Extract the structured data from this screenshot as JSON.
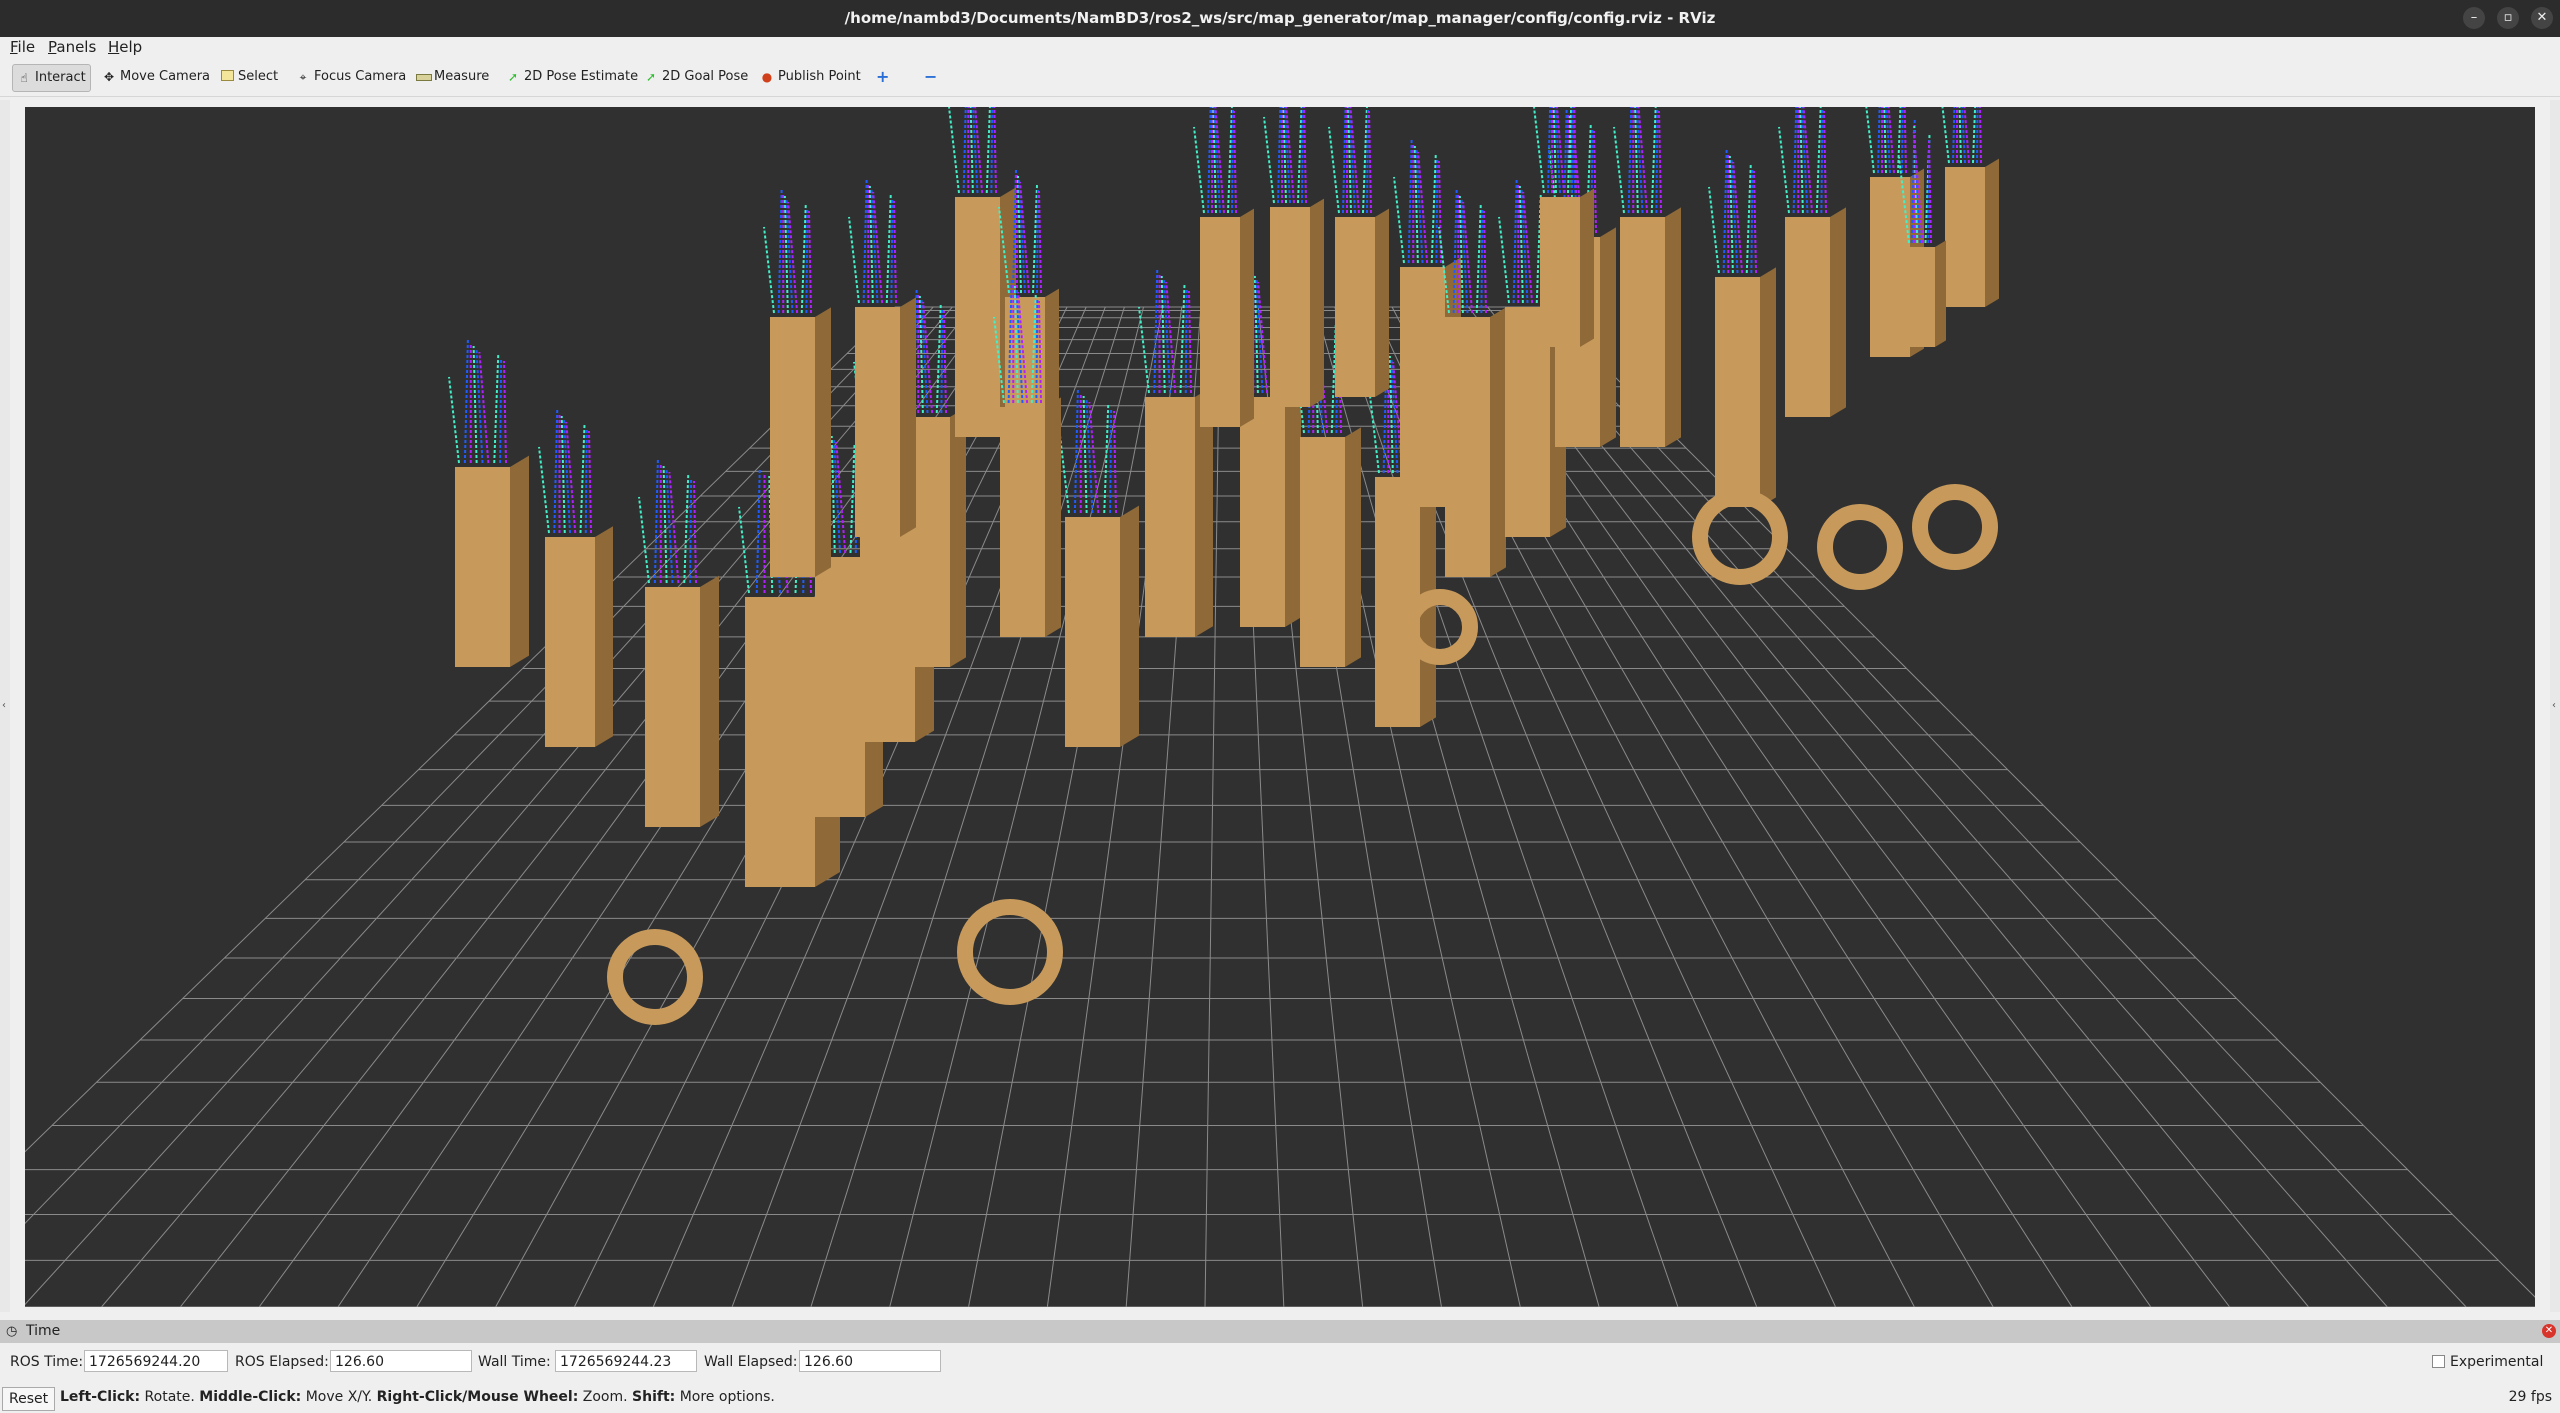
{
  "window": {
    "title": "/home/nambd3/Documents/NamBD3/ros2_ws/src/map_generator/map_manager/config/config.rviz - RViz",
    "minimize_glyph": "–",
    "maximize_glyph": "▫",
    "close_glyph": "✕"
  },
  "menu": {
    "file": {
      "accel": "F",
      "rest": "ile"
    },
    "panels": {
      "accel": "P",
      "rest": "anels"
    },
    "help": {
      "accel": "H",
      "rest": "elp"
    }
  },
  "toolbar": {
    "tools": [
      {
        "label": "Interact",
        "icon": "hand-cursor-icon"
      },
      {
        "label": "Move Camera",
        "icon": "move-camera-icon"
      },
      {
        "label": "Select",
        "icon": "select-box-icon"
      },
      {
        "label": "Focus Camera",
        "icon": "focus-target-icon"
      },
      {
        "label": "Measure",
        "icon": "ruler-icon"
      },
      {
        "label": "2D Pose Estimate",
        "icon": "green-arrow-icon"
      },
      {
        "label": "2D Goal Pose",
        "icon": "green-arrow-icon"
      },
      {
        "label": "Publish Point",
        "icon": "map-pin-icon"
      }
    ],
    "add_tool_glyph": "+",
    "remove_tool_glyph": "−"
  },
  "colors": {
    "viewport_bg": "#303030",
    "grid": "#8a8a8a",
    "obstacle": "#c79a5c",
    "obstacle_dark": "#8f6a38",
    "traj_low": "#40f0c8",
    "traj_mid": "#1e5cff",
    "traj_high": "#b020ff"
  },
  "time_panel": {
    "title": "Time",
    "ros_time_label": "ROS Time:",
    "ros_time": "1726569244.20",
    "ros_elapsed_label": "ROS Elapsed:",
    "ros_elapsed": "126.60",
    "wall_time_label": "Wall Time:",
    "wall_time": "1726569244.23",
    "wall_elapsed_label": "Wall Elapsed:",
    "wall_elapsed": "126.60",
    "experimental_label": "Experimental"
  },
  "status": {
    "reset_label": "Reset",
    "left_click": "Left-Click:",
    "left_click_desc": " Rotate. ",
    "middle_click": "Middle-Click:",
    "middle_click_desc": " Move X/Y. ",
    "right_click": "Right-Click/Mouse Wheel:",
    "right_click_desc": " Zoom. ",
    "shift": "Shift:",
    "shift_desc": " More options.",
    "fps": "29 fps"
  }
}
